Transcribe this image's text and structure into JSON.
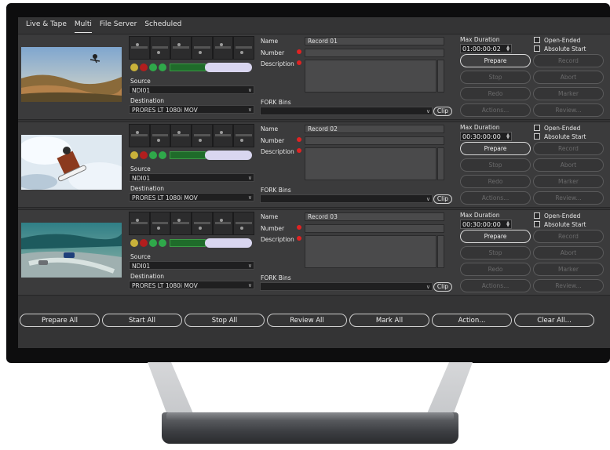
{
  "tabs": [
    "Live & Tape",
    "Multi",
    "File Server",
    "Scheduled"
  ],
  "active_tab": "Multi",
  "labels": {
    "name": "Name",
    "number": "Number",
    "description": "Description",
    "source": "Source",
    "destination": "Destination",
    "fork_bins": "FORK Bins",
    "clip": "Clip",
    "max_duration": "Max Duration",
    "open_ended": "Open-Ended",
    "absolute_start": "Absolute Start"
  },
  "buttons": {
    "prepare": "Prepare",
    "record": "Record",
    "stop": "Stop",
    "abort": "Abort",
    "redo": "Redo",
    "marker": "Marker",
    "actions": "Actions...",
    "review": "Review..."
  },
  "records": [
    {
      "name": "Record 01",
      "number": "",
      "source": "NDI01",
      "destination": "PRORES LT 1080i MOV",
      "max_duration": "01:00:00:02",
      "fork_bins": ""
    },
    {
      "name": "Record 02",
      "number": "",
      "source": "NDI01",
      "destination": "PRORES LT 1080i MOV",
      "max_duration": "00:30:00:00",
      "fork_bins": ""
    },
    {
      "name": "Record 03",
      "number": "",
      "source": "NDI01",
      "destination": "PRORES LT 1080i MOV",
      "max_duration": "00:30:00:00",
      "fork_bins": ""
    }
  ],
  "bottom_buttons": [
    "Prepare All",
    "Start All",
    "Stop All",
    "Review All",
    "Mark All",
    "Action...",
    "Clear All..."
  ],
  "colors": {
    "screen_bg": "#343435",
    "row_bg": "#3b3b3c",
    "required_dot": "#e02323",
    "led_yellow": "#c9b23a",
    "led_red": "#b21e1e",
    "led_green": "#2fa84a",
    "pill": "#d9d6f0"
  }
}
